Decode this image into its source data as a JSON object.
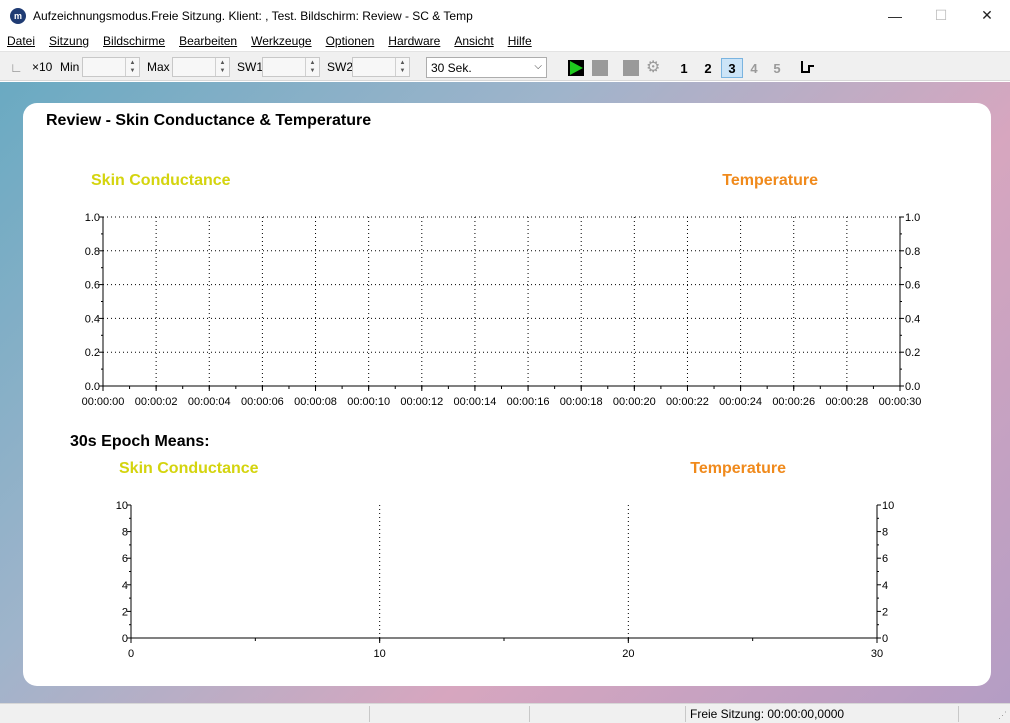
{
  "window": {
    "title": "Aufzeichnungsmodus.Freie Sitzung. Klient: , Test. Bildschirm: Review - SC & Temp",
    "app_icon_glyph": "m",
    "controls": {
      "minimize": "—",
      "maximize": "☐",
      "close": "✕"
    }
  },
  "menu": {
    "items": [
      "Datei",
      "Sitzung",
      "Bildschirme",
      "Bearbeiten",
      "Werkzeuge",
      "Optionen",
      "Hardware",
      "Ansicht",
      "Hilfe"
    ]
  },
  "toolbar": {
    "scale_icon_glyph": "∟",
    "x10_label": "×10",
    "min_label": "Min",
    "max_label": "Max",
    "sw1_label": "SW1",
    "sw2_label": "SW2",
    "min_value": "",
    "max_value": "",
    "sw1_value": "",
    "sw2_value": "",
    "spin_up": "▲",
    "spin_down": "▼",
    "duration_value": "30 Sek.",
    "duration_chevron": "⌵",
    "gear_glyph": "⚙",
    "screen_buttons": [
      "1",
      "2",
      "3",
      "4",
      "5"
    ],
    "active_screen": "3",
    "step_icon_glyph": "⊓",
    "colors": {
      "play": "#1ec81e",
      "stop": "#9a9a9a",
      "active_btn": "#cce4f7"
    }
  },
  "panel": {
    "title": "Review - Skin Conductance & Temperature",
    "epoch_title": "30s Epoch Means:"
  },
  "chart_data": [
    {
      "type": "line",
      "left_label": "Skin Conductance",
      "right_label": "Temperature",
      "left_label_color": "#d4d40e",
      "right_label_color": "#f08a1c",
      "x_ticks": [
        "00:00:00",
        "00:00:02",
        "00:00:04",
        "00:00:06",
        "00:00:08",
        "00:00:10",
        "00:00:12",
        "00:00:14",
        "00:00:16",
        "00:00:18",
        "00:00:20",
        "00:00:22",
        "00:00:24",
        "00:00:26",
        "00:00:28",
        "00:00:30"
      ],
      "y_ticks": [
        "0.0",
        "0.2",
        "0.4",
        "0.6",
        "0.8",
        "1.0"
      ],
      "ylim": [
        0,
        1
      ],
      "grid": "dotted",
      "series": []
    },
    {
      "type": "bar",
      "left_label": "Skin Conductance",
      "right_label": "Temperature",
      "left_label_color": "#d4d40e",
      "right_label_color": "#f08a1c",
      "x_ticks": [
        "0",
        "10",
        "20",
        "30"
      ],
      "y_ticks": [
        "0",
        "2",
        "4",
        "6",
        "8",
        "10"
      ],
      "xlim": [
        0,
        30
      ],
      "ylim": [
        0,
        10
      ],
      "grid": "dotted",
      "series": []
    }
  ],
  "status": {
    "session_text": "Freie Sitzung: 00:00:00,0000",
    "grip_glyph": "⋰"
  }
}
